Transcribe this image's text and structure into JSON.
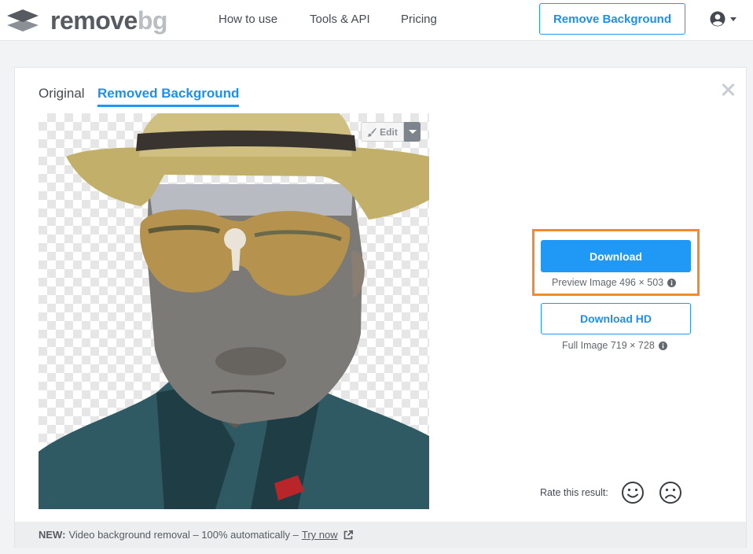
{
  "brand": {
    "name_part1": "remove",
    "name_part2": "bg",
    "logo_icon": "layers-icon"
  },
  "nav": {
    "links": [
      "How to use",
      "Tools & API",
      "Pricing"
    ],
    "cta_label": "Remove Background",
    "account_icon": "user-circle-icon"
  },
  "tabs": {
    "original": "Original",
    "removed": "Removed Background",
    "active": "removed"
  },
  "editor": {
    "edit_label": "Edit",
    "edit_icon": "brush-icon"
  },
  "download": {
    "button_label": "Download",
    "preview_text": "Preview Image 496 × 503",
    "hd_button_label": "Download HD",
    "full_text": "Full Image 719 × 728",
    "info_icon": "info-icon"
  },
  "rating": {
    "label": "Rate this result:",
    "positive_icon": "smile-icon",
    "negative_icon": "frown-icon"
  },
  "banner": {
    "prefix": "NEW:",
    "message": "Video background removal – 100% automatically –",
    "link": "Try now",
    "link_icon": "external-link-icon"
  },
  "colors": {
    "accent": "#1e98f0",
    "highlight": "#f58a2a",
    "banner_bg": "#eceef0"
  }
}
